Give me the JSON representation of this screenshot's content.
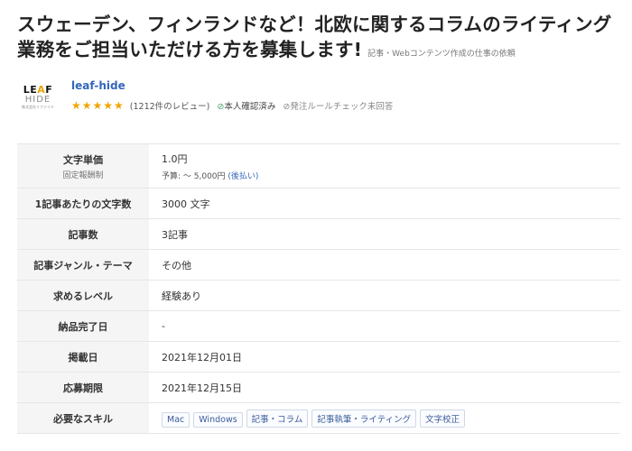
{
  "job": {
    "title": "スウェーデン、フィンランドなど！北欧に関するコラムのライティング業務をご担当いただける方を募集します!",
    "category": "記事・Webコンテンツ作成の仕事の依頼"
  },
  "client": {
    "logo_line1_pre": "LE",
    "logo_line1_accent": "A",
    "logo_line1_post": "F",
    "logo_line2": "HIDE",
    "logo_line3": "株式会社リファイド",
    "name": "leaf-hide",
    "stars": "★★★★★",
    "reviews": "(1212件のレビュー)",
    "verified_icon": "⊘",
    "verified_label": "本人確認済み",
    "rule_icon": "⊘",
    "rule_label": "発注ルールチェック未回答"
  },
  "details": {
    "price_label": "文字単価",
    "price_sublabel": "固定報酬制",
    "price_value": "1.0円",
    "budget_prefix": "予算: ～ 5,000円 ",
    "budget_link": "(後払い)",
    "words_label": "1記事あたりの文字数",
    "words_value": "3000 文字",
    "count_label": "記事数",
    "count_value": "3記事",
    "genre_label": "記事ジャンル・テーマ",
    "genre_value": "その他",
    "level_label": "求めるレベル",
    "level_value": "経験あり",
    "delivery_label": "納品完了日",
    "delivery_value": "-",
    "posted_label": "掲載日",
    "posted_value": "2021年12月01日",
    "deadline_label": "応募期限",
    "deadline_value": "2021年12月15日",
    "skills_label": "必要なスキル",
    "skills": [
      "Mac",
      "Windows",
      "記事・コラム",
      "記事執筆・ライティング",
      "文字校正"
    ]
  }
}
